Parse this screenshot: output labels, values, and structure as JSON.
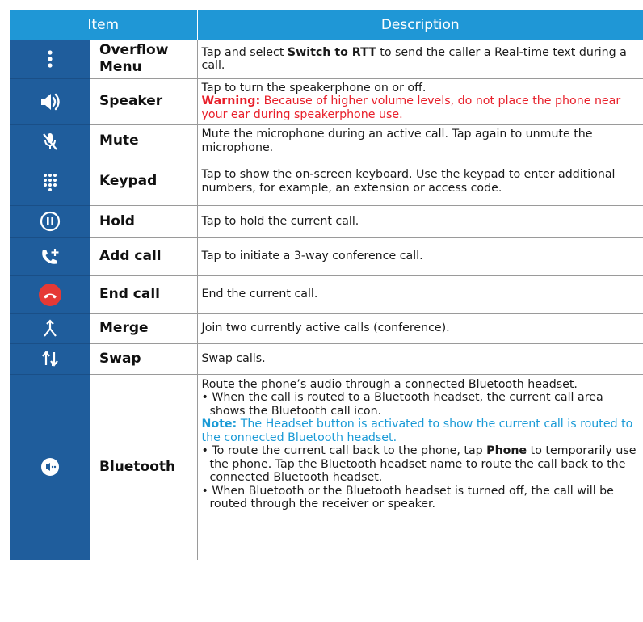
{
  "header": {
    "item": "Item",
    "description": "Description"
  },
  "rows": [
    {
      "icon": "overflow-menu-icon",
      "item_line1": "Overflow",
      "item_line2": "Menu",
      "desc_pre": "Tap and select ",
      "desc_bold": "Switch to RTT",
      "desc_post": " to send the caller a Real-time text during a call."
    },
    {
      "icon": "speaker-icon",
      "item": "Speaker",
      "desc": "Tap to turn the speakerphone on or off.",
      "warning_label": "Warning:",
      "warning_text": " Because of higher volume levels, do not place the phone near your ear during speakerphone use."
    },
    {
      "icon": "mute-icon",
      "item": "Mute",
      "desc": "Mute the microphone during an active call. Tap again to unmute the microphone."
    },
    {
      "icon": "keypad-icon",
      "item": "Keypad",
      "desc": "Tap to show the on-screen keyboard. Use the keypad to enter additional numbers, for example, an extension or access code."
    },
    {
      "icon": "hold-icon",
      "item": "Hold",
      "desc": "Tap to hold the current call."
    },
    {
      "icon": "add-call-icon",
      "item": "Add call",
      "desc": "Tap to initiate a 3-way conference call."
    },
    {
      "icon": "end-call-icon",
      "item": "End call",
      "desc": "End the current call."
    },
    {
      "icon": "merge-icon",
      "item": "Merge",
      "desc": "Join two currently active calls (conference)."
    },
    {
      "icon": "swap-icon",
      "item": "Swap",
      "desc": "Swap calls."
    },
    {
      "icon": "bluetooth-icon",
      "item": "Bluetooth",
      "desc_intro": "Route the phone’s audio through a connected Bluetooth headset.",
      "bullet1": "• When the call is routed to a Bluetooth headset, the current call area shows the Bluetooth call icon.",
      "note_label": "Note:",
      "note_text": " The Headset button is activated to show the current call is routed to the connected Bluetooth headset.",
      "bullet2_pre": "• To route the current call back to the phone, tap ",
      "bullet2_bold": "Phone",
      "bullet2_post": " to temporarily use the phone. Tap the Bluetooth headset name to route the call back to the connected Bluetooth headset.",
      "bullet3": "• When Bluetooth or the Bluetooth headset is turned off, the call will be routed through the receiver or speaker."
    }
  ],
  "colors": {
    "header": "#1f97d6",
    "icon_column": "#1f5d9c",
    "warning": "#e8202b",
    "note": "#1a9ad6",
    "end_call": "#e53935"
  }
}
